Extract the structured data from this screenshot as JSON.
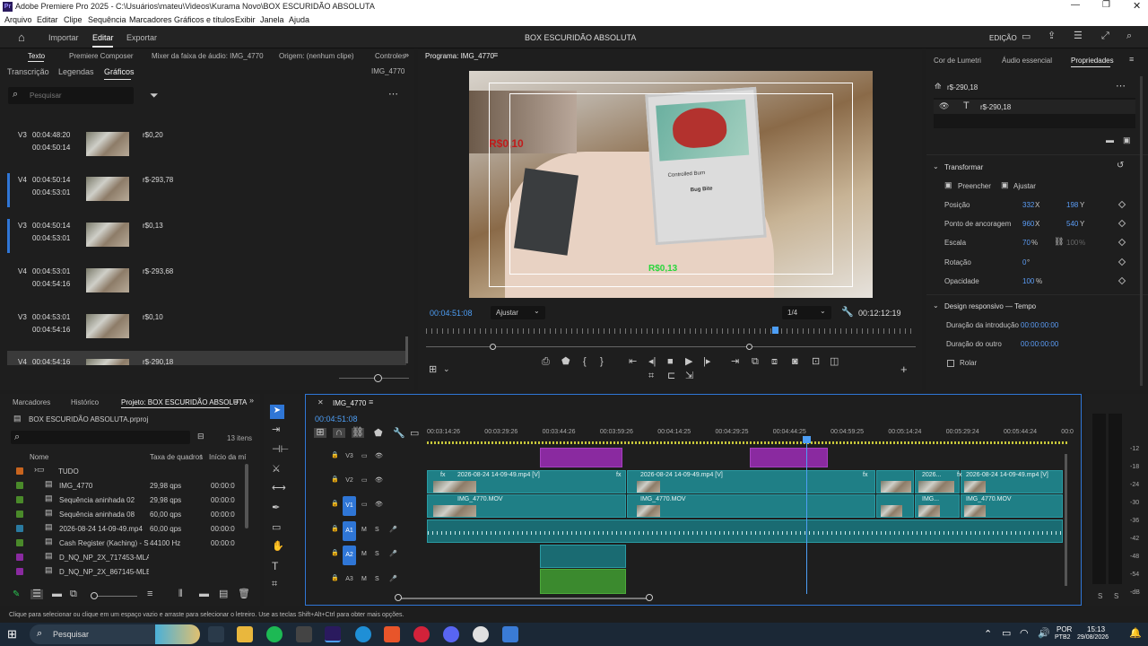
{
  "window": {
    "title": "Adobe Premiere Pro 2025 - C:\\Usuários\\mateu\\Videos\\Kurama Novo\\BOX ESCURIDÃO ABSOLUTA",
    "app_badge": "Pr"
  },
  "menu": [
    "Arquivo",
    "Editar",
    "Clipe",
    "Sequência",
    "Marcadores",
    "Gráficos e títulos",
    "Exibir",
    "Janela",
    "Ajuda"
  ],
  "workspace": {
    "tabs": [
      "Importar",
      "Editar",
      "Exportar"
    ],
    "active": "Editar",
    "project_title": "BOX ESCURIDÃO ABSOLUTA",
    "mode": "EDIÇÃO"
  },
  "left_panel": {
    "top_tabs": [
      "Texto",
      "Premiere Composer",
      "Mixer da faixa de áudio: IMG_4770",
      "Origem: (nenhum clipe)",
      "Controles"
    ],
    "sub_tabs": [
      "Transcrição",
      "Legendas",
      "Gráficos"
    ],
    "sub_active": "Gráficos",
    "clip_name": "IMG_4770",
    "search_placeholder": "Pesquisar",
    "items": [
      {
        "track": "V3",
        "in": "00:04:48:20",
        "out": "00:04:50:14",
        "text": "r$0,20",
        "selected": false
      },
      {
        "track": "V4",
        "in": "00:04:50:14",
        "out": "00:04:53:01",
        "text": "r$-293,78",
        "selected": true
      },
      {
        "track": "V3",
        "in": "00:04:50:14",
        "out": "00:04:53:01",
        "text": "r$0,13",
        "selected": true
      },
      {
        "track": "V4",
        "in": "00:04:53:01",
        "out": "00:04:54:16",
        "text": "r$-293,68",
        "selected": false
      },
      {
        "track": "V3",
        "in": "00:04:53:01",
        "out": "00:04:54:16",
        "text": "r$0,10",
        "selected": false
      },
      {
        "track": "V4",
        "in": "00:04:54:16",
        "out": "",
        "text": "r$-290,18",
        "selected": false
      }
    ]
  },
  "program": {
    "title": "Programa: IMG_4770",
    "timecode": "00:04:51:08",
    "fit": "Ajustar",
    "resolution": "1/4",
    "duration": "00:12:12:19",
    "overlay_left": "R$0,10",
    "overlay_green": "R$0,13",
    "card_name": "Bug Bite",
    "card_attack": "Controlled Burn"
  },
  "right_panel": {
    "tabs": [
      "Cor de Lumetri",
      "Áudio essencial",
      "Propriedades"
    ],
    "active": "Propriedades",
    "layer_title": "r$-290,18",
    "layer_item": "r$-290,18",
    "transform": {
      "header": "Transformar",
      "fill": "Preencher",
      "fit": "Ajustar",
      "rows": [
        {
          "label": "Posição",
          "v1": "332",
          "u1": "X",
          "v2": "198",
          "u2": "Y"
        },
        {
          "label": "Ponto de ancoragem",
          "v1": "960",
          "u1": "X",
          "v2": "540",
          "u2": "Y"
        },
        {
          "label": "Escala",
          "v1": "70",
          "u1": "%",
          "v2": "100",
          "u2": "%"
        },
        {
          "label": "Rotação",
          "v1": "0",
          "u1": "°",
          "v2": "",
          "u2": ""
        },
        {
          "label": "Opacidade",
          "v1": "100",
          "u1": "%",
          "v2": "",
          "u2": ""
        }
      ]
    },
    "responsive": {
      "header": "Design responsivo — Tempo",
      "intro_label": "Duração da introdução",
      "intro": "00:00:00:00",
      "outro_label": "Duração do outro",
      "outro": "00:00:00:00",
      "roll": "Rolar"
    }
  },
  "project_panel": {
    "tabs": [
      "Marcadores",
      "Histórico",
      "Projeto: BOX ESCURIDÃO ABSOLUTA"
    ],
    "file": "BOX ESCURIDÃO ABSOLUTA.prproj",
    "count": "13 itens",
    "columns": [
      "Nome",
      "Taxa de quadros",
      "Início da mí"
    ],
    "rows": [
      {
        "name": "TUDO",
        "rate": "",
        "start": "",
        "color": "#c8641e"
      },
      {
        "name": "IMG_4770",
        "rate": "29,98 qps",
        "start": "00:00:0",
        "color": "#4a8a2a"
      },
      {
        "name": "Sequência aninhada 02",
        "rate": "29,98 qps",
        "start": "00:00:0",
        "color": "#4a8a2a"
      },
      {
        "name": "Sequência aninhada 08",
        "rate": "60,00 qps",
        "start": "00:00:0",
        "color": "#4a8a2a"
      },
      {
        "name": "2026-08-24 14-09-49.mp4",
        "rate": "60,00 qps",
        "start": "00:00:0",
        "color": "#2a7aa0"
      },
      {
        "name": "Cash Register (Kaching) - So",
        "rate": "44100 Hz",
        "start": "00:00:0",
        "color": "#4a8a2a"
      },
      {
        "name": "D_NQ_NP_2X_717453-MLA",
        "rate": "",
        "start": "",
        "color": "#8a2aa0"
      },
      {
        "name": "D_NQ_NP_2X_867145-MLB",
        "rate": "",
        "start": "",
        "color": "#8a2aa0"
      }
    ]
  },
  "timeline": {
    "name": "IMG_4770",
    "timecode": "00:04:51:08",
    "ruler": [
      "00:03:14:26",
      "00:03:29:26",
      "00:03:44:26",
      "00:03:59:26",
      "00:04:14:25",
      "00:04:29:25",
      "00:04:44:25",
      "00:04:59:25",
      "00:05:14:24",
      "00:05:29:24",
      "00:05:44:24",
      "00:0"
    ],
    "video_tracks": [
      "V3",
      "V2",
      "V1"
    ],
    "audio_tracks": [
      "A1",
      "A2",
      "A3"
    ],
    "clip_v2": "2026-08-24 14-09-49.mp4 [V]",
    "clip_v2_short": "2026...",
    "clip_v1": "IMG_4770.MOV",
    "clip_v1_short": "IMG...",
    "fx": "fx"
  },
  "meter": {
    "labels": [
      "-12",
      "-18",
      "-24",
      "-30",
      "-36",
      "-42",
      "-48",
      "-54",
      "-dB"
    ],
    "solo": [
      "S",
      "S"
    ]
  },
  "status": "Clique para selecionar ou clique em um espaço vazio e arraste para selecionar o letreiro. Use as teclas Shift+Alt+Ctrl para obter mais opções.",
  "taskbar": {
    "search": "Pesquisar",
    "lang": "POR",
    "layout": "PTB2",
    "time": "15:13",
    "date": "29/08/2026"
  }
}
